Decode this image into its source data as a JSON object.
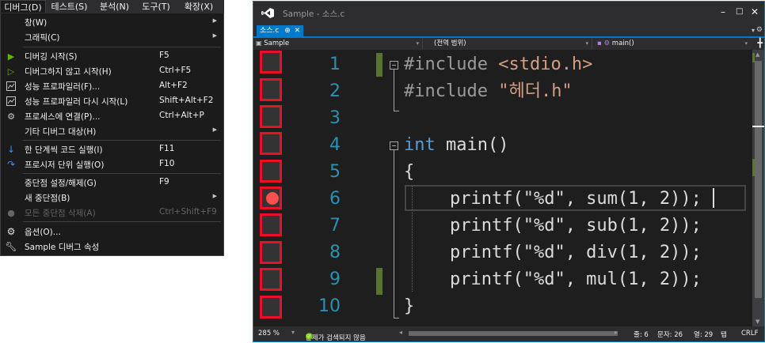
{
  "menubar": {
    "items": [
      "디버그(D)",
      "테스트(S)",
      "분석(N)",
      "도구(T)",
      "확장(X)"
    ]
  },
  "debug_menu": {
    "items": [
      {
        "icon": "",
        "label": "창(W)",
        "shortcut": "",
        "submenu": true,
        "disabled": false
      },
      {
        "icon": "",
        "label": "그래픽(C)",
        "shortcut": "",
        "submenu": true,
        "disabled": false
      },
      {
        "icon": "play-icon",
        "label": "디버깅 시작(S)",
        "shortcut": "F5",
        "submenu": false,
        "disabled": false
      },
      {
        "icon": "play-outline-icon",
        "label": "디버그하지 않고 시작(H)",
        "shortcut": "Ctrl+F5",
        "submenu": false,
        "disabled": false
      },
      {
        "icon": "profiler-icon",
        "label": "성능 프로파일러(F)...",
        "shortcut": "Alt+F2",
        "submenu": false,
        "disabled": false
      },
      {
        "icon": "profiler-relaunch-icon",
        "label": "성능 프로파일러 다시 시작(L)",
        "shortcut": "Shift+Alt+F2",
        "submenu": false,
        "disabled": false
      },
      {
        "icon": "attach-process-icon",
        "label": "프로세스에 연결(P)...",
        "shortcut": "Ctrl+Alt+P",
        "submenu": false,
        "disabled": false
      },
      {
        "icon": "",
        "label": "기타 디버그 대상(H)",
        "shortcut": "",
        "submenu": true,
        "disabled": false
      },
      {
        "icon": "step-into-icon",
        "label": "한 단계씩 코드 실행(I)",
        "shortcut": "F11",
        "submenu": false,
        "disabled": false
      },
      {
        "icon": "step-over-icon",
        "label": "프로시저 단위 실행(O)",
        "shortcut": "F10",
        "submenu": false,
        "disabled": false
      },
      {
        "icon": "",
        "label": "중단점 설정/해제(G)",
        "shortcut": "F9",
        "submenu": false,
        "disabled": false
      },
      {
        "icon": "",
        "label": "새 중단점(B)",
        "shortcut": "",
        "submenu": true,
        "disabled": false
      },
      {
        "icon": "delete-breakpoints-icon",
        "label": "모든 중단점 삭제(A)",
        "shortcut": "Ctrl+Shift+F9",
        "submenu": false,
        "disabled": true
      },
      {
        "icon": "gear-icon",
        "label": "옵션(O)...",
        "shortcut": "",
        "submenu": false,
        "disabled": false
      },
      {
        "icon": "wrench-icon",
        "label": "Sample 디버그 속성",
        "shortcut": "",
        "submenu": false,
        "disabled": false
      }
    ]
  },
  "window": {
    "title": "Sample - 소스.c",
    "tab": {
      "label": "소스.c",
      "pin": "⊕",
      "close": "✕"
    },
    "nav": {
      "project": "Sample",
      "scope": "(전역 범위)",
      "function": "main()"
    },
    "line_numbers": [
      "1",
      "2",
      "3",
      "4",
      "5",
      "6",
      "7",
      "8",
      "9",
      "10"
    ],
    "code": {
      "l1_directive": "#include",
      "l1_header": "<stdio.h>",
      "l2_directive": "#include",
      "l2_header": "\"헤더.h\"",
      "l4_type": "int",
      "l4_rest": " main()",
      "l5": "{",
      "l6": "printf(\"%d\", sum(1, 2));",
      "l7": "printf(\"%d\", sub(1, 2));",
      "l8": "printf(\"%d\", div(1, 2));",
      "l9": "printf(\"%d\", mul(1, 2));",
      "l10": "}"
    },
    "breakpoint_line": 6,
    "status": {
      "zoom": "285 %",
      "issues": "문제가 검색되지 않음",
      "line": "줄: 6",
      "char": "문자: 26",
      "col": "열: 29",
      "tab": "탭",
      "eol": "CRLF"
    }
  },
  "colors": {
    "accent": "#007acc",
    "highlight_box": "#e81123",
    "breakpoint": "#ff4f4f",
    "keyword": "#569cd6",
    "string": "#d69d85",
    "line_number": "#2b91af",
    "changed_marker": "#577430"
  }
}
